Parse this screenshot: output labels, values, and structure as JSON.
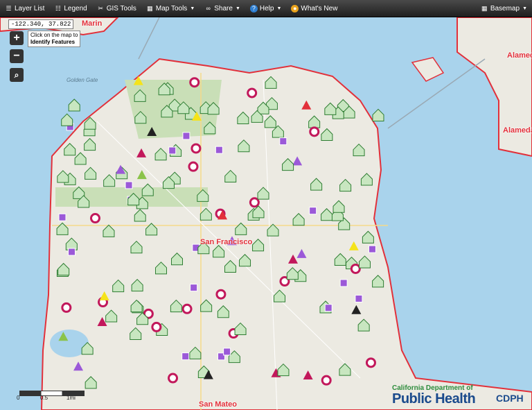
{
  "toolbar": {
    "items": [
      {
        "label": "Layer List",
        "icon": "layer-list-icon"
      },
      {
        "label": "Legend",
        "icon": "legend-icon"
      },
      {
        "label": "GIS Tools",
        "icon": "gis-tools-icon"
      },
      {
        "label": "Map Tools",
        "icon": "map-tools-icon"
      },
      {
        "label": "Share",
        "icon": "share-icon"
      },
      {
        "label": "Help",
        "icon": "help-icon"
      },
      {
        "label": "What's New",
        "icon": "whats-new-icon"
      }
    ],
    "basemap_label": "Basemap"
  },
  "coordinates": "-122.340, 37.822",
  "identify_hint": {
    "line1": "Click on the map to",
    "line2": "Identify Features"
  },
  "map_labels": {
    "san_francisco": "San Francisco",
    "marin": "Marin",
    "alameda_top": "Alameda",
    "alameda_right": "Alameda",
    "san_mateo": "San Mateo",
    "golden_gate": "Golden Gate"
  },
  "scale": {
    "zero": "0",
    "half": "0.5",
    "one": "1mi"
  },
  "logo": {
    "line1": "California Department of",
    "line2": "Public Health",
    "mark": "CDPH"
  },
  "colors": {
    "county_border": "#e2303a",
    "facility_green": "#c8e6c0",
    "marker_purple": "#9b59d8",
    "marker_magenta": "#c2185b",
    "water": "#a9d3ec",
    "land": "#eceae2"
  }
}
